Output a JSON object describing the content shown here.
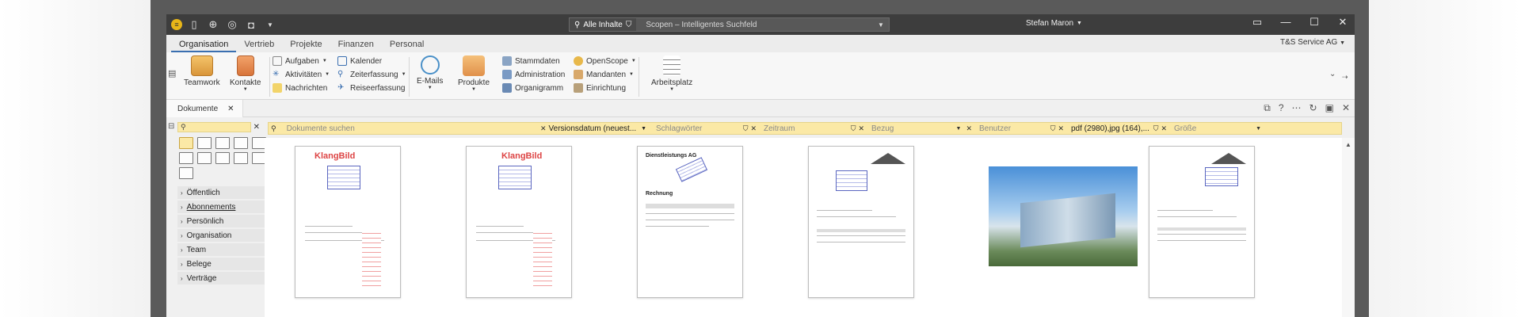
{
  "titlebar": {
    "scope_label": "Alle Inhalte",
    "search_placeholder": "Scopen – Intelligentes Suchfeld",
    "user": "Stefan Maron"
  },
  "ribbon_tabs": [
    "Organisation",
    "Vertrieb",
    "Projekte",
    "Finanzen",
    "Personal"
  ],
  "company": "T&S Service AG",
  "ribbon": {
    "teamwork": "Teamwork",
    "kontakte": "Kontakte",
    "aufgaben": "Aufgaben",
    "aktivitaeten": "Aktivitäten",
    "nachrichten": "Nachrichten",
    "kalender": "Kalender",
    "zeiterfassung": "Zeiterfassung",
    "reiseerfassung": "Reiseerfassung",
    "emails": "E-Mails",
    "produkte": "Produkte",
    "stammdaten": "Stammdaten",
    "administration": "Administration",
    "organigramm": "Organigramm",
    "openscope": "OpenScope",
    "mandanten": "Mandanten",
    "einrichtung": "Einrichtung",
    "arbeitsplatz": "Arbeitsplatz"
  },
  "doc_tab": "Dokumente",
  "filters": {
    "search_placeholder": "Dokumente suchen",
    "sort": "Versionsdatum (neuest...",
    "schlagwoerter": "Schlagwörter",
    "zeitraum": "Zeitraum",
    "bezug": "Bezug",
    "benutzer": "Benutzer",
    "types": "pdf (2980),jpg (164),...",
    "groesse": "Größe"
  },
  "tree": [
    "Öffentlich",
    "Abonnements",
    "Persönlich",
    "Organisation",
    "Team",
    "Belege",
    "Verträge"
  ],
  "thumb_texts": {
    "brand": "KlangBild",
    "company_doc": "Dienstleistungs AG",
    "invoice": "Rechnung"
  },
  "colors": {
    "accent": "#3a6fb0",
    "filter_bg": "#fbe9a6",
    "titlebar": "#3d3d3d"
  }
}
